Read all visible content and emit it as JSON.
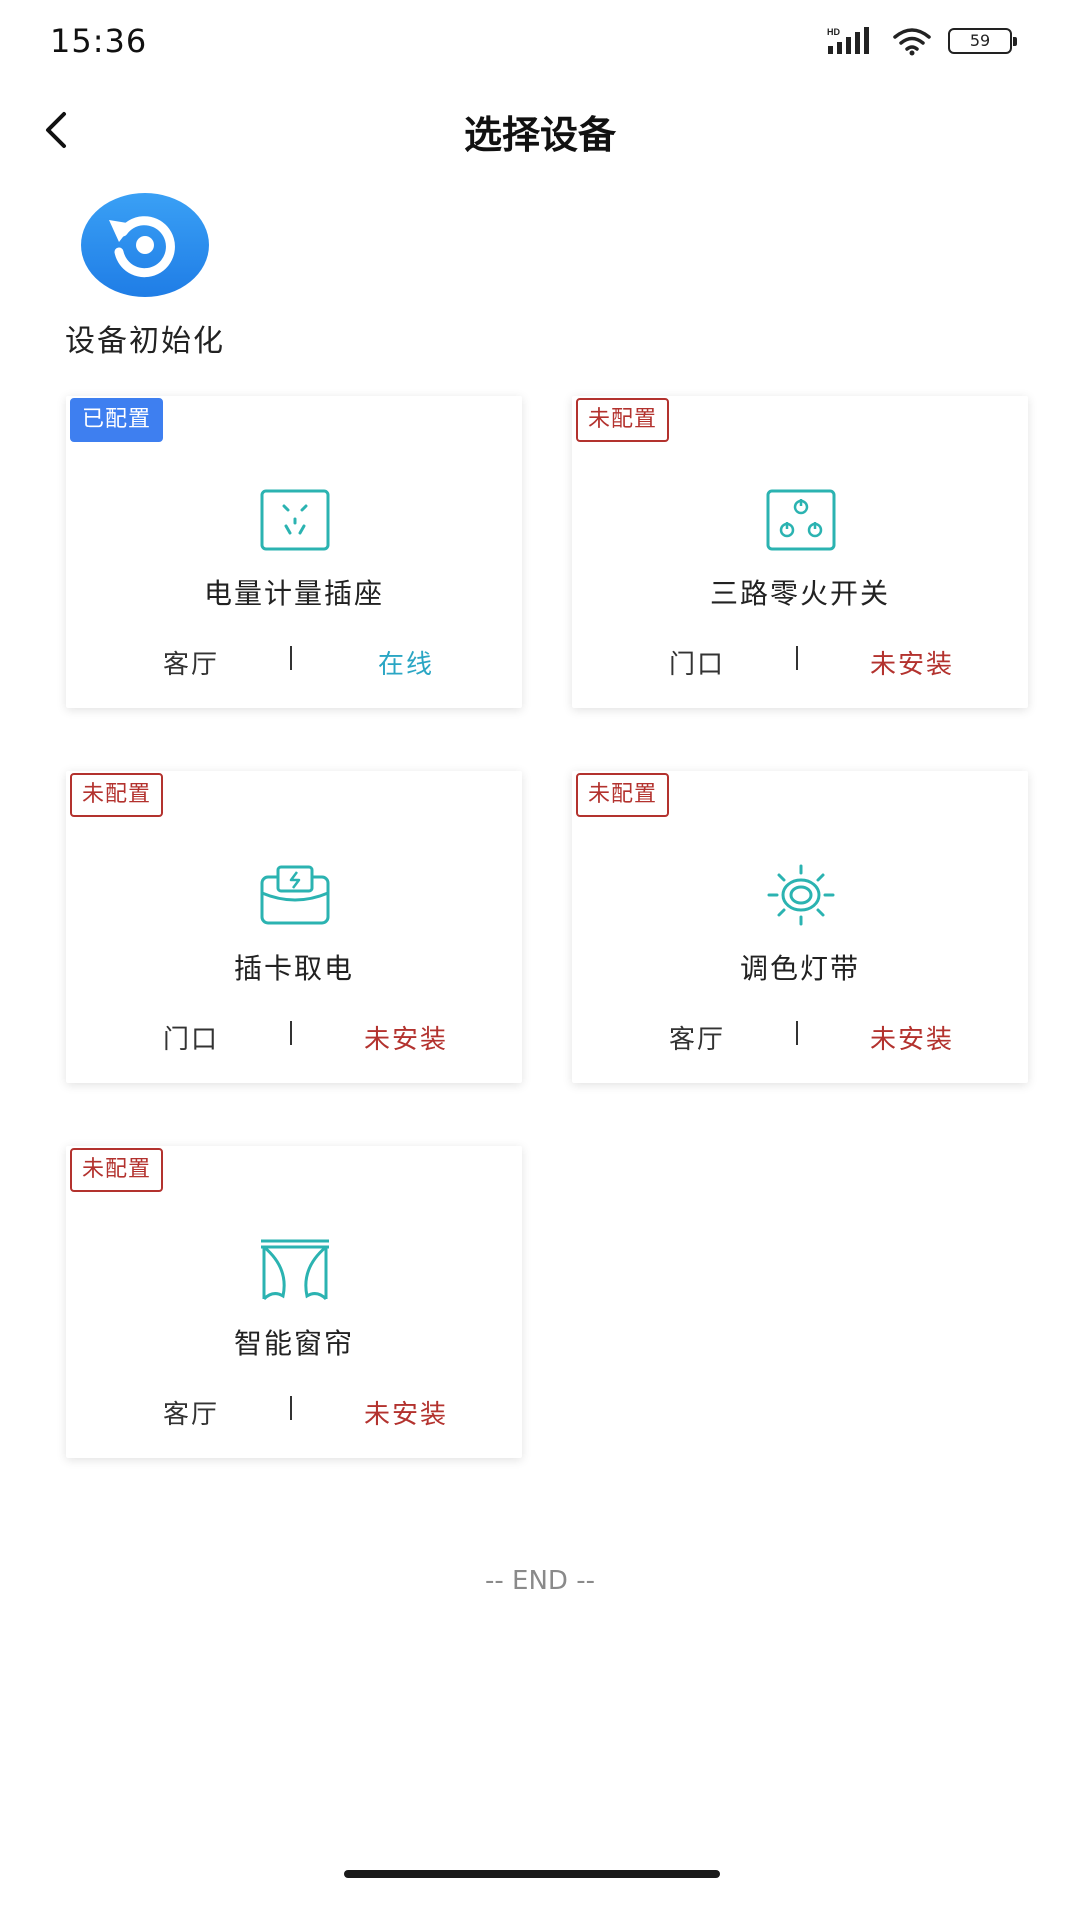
{
  "status_bar": {
    "time": "15:36",
    "network_label": "HD",
    "battery": "59"
  },
  "header": {
    "title": "选择设备"
  },
  "init": {
    "label": "设备初始化",
    "icon": "reset-icon"
  },
  "colors": {
    "accent_blue": "#3e7ff0",
    "teal_icon": "#2bb3b1",
    "online": "#2aa6c4",
    "warning_red": "#b3322e"
  },
  "devices": [
    {
      "badge": "已配置",
      "badge_state": "configured",
      "icon": "socket-icon",
      "name": "电量计量插座",
      "location": "客厅",
      "status": "在线",
      "status_type": "online"
    },
    {
      "badge": "未配置",
      "badge_state": "unconfigured",
      "icon": "switch-icon",
      "name": "三路零火开关",
      "location": "门口",
      "status": "未安装",
      "status_type": "uninstalled"
    },
    {
      "badge": "未配置",
      "badge_state": "unconfigured",
      "icon": "card-power-icon",
      "name": "插卡取电",
      "location": "门口",
      "status": "未安装",
      "status_type": "uninstalled"
    },
    {
      "badge": "未配置",
      "badge_state": "unconfigured",
      "icon": "light-strip-icon",
      "name": "调色灯带",
      "location": "客厅",
      "status": "未安装",
      "status_type": "uninstalled"
    },
    {
      "badge": "未配置",
      "badge_state": "unconfigured",
      "icon": "curtain-icon",
      "name": "智能窗帘",
      "location": "客厅",
      "status": "未安装",
      "status_type": "uninstalled"
    }
  ],
  "footer": {
    "end_text": "-- END --"
  }
}
